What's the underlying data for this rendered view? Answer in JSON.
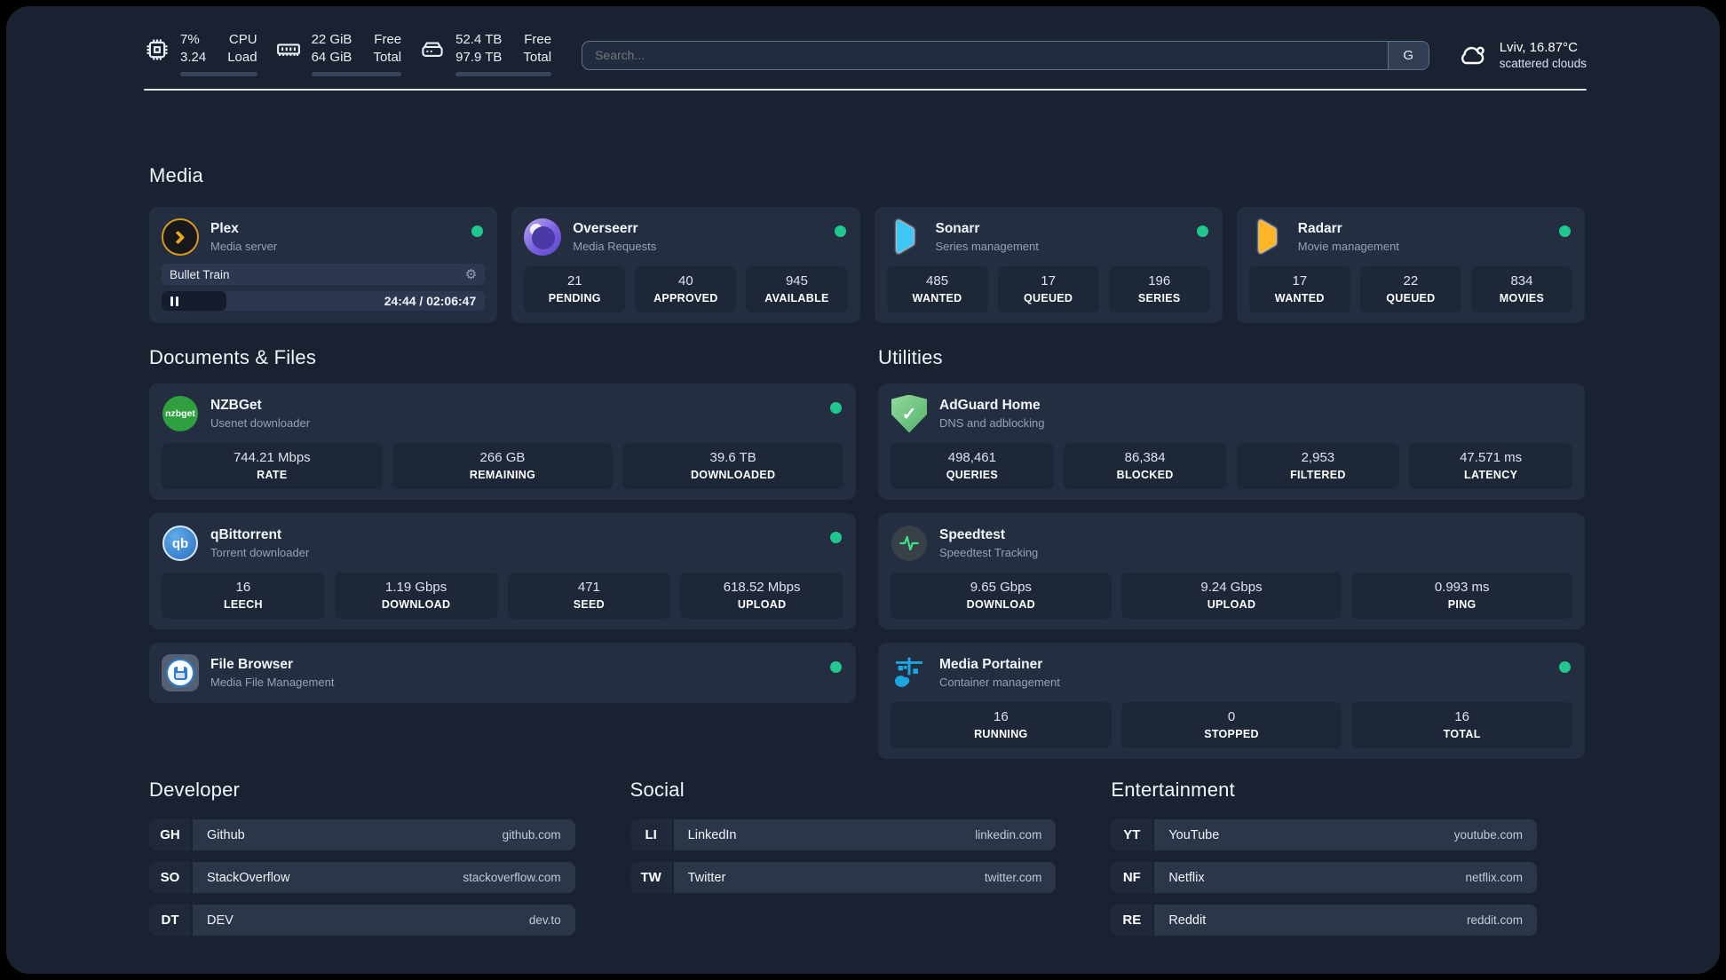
{
  "theme": {
    "accent_green": "#22c78e",
    "card_bg": "#242e41",
    "page_bg": "#1a2232"
  },
  "header": {
    "metrics": [
      {
        "icon": "cpu-icon",
        "value1": "7%",
        "value2": "3.24",
        "label1": "CPU",
        "label2": "Load",
        "progress": 12
      },
      {
        "icon": "ram-icon",
        "value1": "22 GiB",
        "value2": "64 GiB",
        "label1": "Free",
        "label2": "Total",
        "progress": 68
      },
      {
        "icon": "disk-icon",
        "value1": "52.4 TB",
        "value2": "97.9 TB",
        "label1": "Free",
        "label2": "Total",
        "progress": 47
      }
    ],
    "search": {
      "placeholder": "Search...",
      "provider_label": "G"
    },
    "weather": {
      "icon": "cloud-icon",
      "location": "Lviv, 16.87°C",
      "condition": "scattered clouds"
    }
  },
  "icons": {
    "nzbget_text": "nzbget",
    "qbittorrent_text": "qb",
    "adguard_check": "✓",
    "gear": "⚙"
  },
  "media": {
    "title": "Media",
    "cards": [
      {
        "name": "Plex",
        "subtitle": "Media server",
        "online": true,
        "player": {
          "now_playing": "Bullet Train",
          "time": "24:44 / 02:06:47",
          "progress": 20
        }
      },
      {
        "name": "Overseerr",
        "subtitle": "Media Requests",
        "online": true,
        "stats": [
          {
            "value": "21",
            "label": "PENDING"
          },
          {
            "value": "40",
            "label": "APPROVED"
          },
          {
            "value": "945",
            "label": "AVAILABLE"
          }
        ]
      },
      {
        "name": "Sonarr",
        "subtitle": "Series management",
        "online": true,
        "stats": [
          {
            "value": "485",
            "label": "WANTED"
          },
          {
            "value": "17",
            "label": "QUEUED"
          },
          {
            "value": "196",
            "label": "SERIES"
          }
        ]
      },
      {
        "name": "Radarr",
        "subtitle": "Movie management",
        "online": true,
        "stats": [
          {
            "value": "17",
            "label": "WANTED"
          },
          {
            "value": "22",
            "label": "QUEUED"
          },
          {
            "value": "834",
            "label": "MOVIES"
          }
        ]
      }
    ]
  },
  "documents": {
    "title": "Documents & Files",
    "cards": [
      {
        "name": "NZBGet",
        "subtitle": "Usenet downloader",
        "online": true,
        "stats": [
          {
            "value": "744.21 Mbps",
            "label": "RATE"
          },
          {
            "value": "266 GB",
            "label": "REMAINING"
          },
          {
            "value": "39.6 TB",
            "label": "DOWNLOADED"
          }
        ]
      },
      {
        "name": "qBittorrent",
        "subtitle": "Torrent downloader",
        "online": true,
        "stats": [
          {
            "value": "16",
            "label": "LEECH"
          },
          {
            "value": "1.19 Gbps",
            "label": "DOWNLOAD"
          },
          {
            "value": "471",
            "label": "SEED"
          },
          {
            "value": "618.52 Mbps",
            "label": "UPLOAD"
          }
        ]
      },
      {
        "name": "File Browser",
        "subtitle": "Media File Management",
        "online": true
      }
    ]
  },
  "utilities": {
    "title": "Utilities",
    "cards": [
      {
        "name": "AdGuard Home",
        "subtitle": "DNS and adblocking",
        "stats": [
          {
            "value": "498,461",
            "label": "QUERIES"
          },
          {
            "value": "86,384",
            "label": "BLOCKED"
          },
          {
            "value": "2,953",
            "label": "FILTERED"
          },
          {
            "value": "47.571 ms",
            "label": "LATENCY"
          }
        ]
      },
      {
        "name": "Speedtest",
        "subtitle": "Speedtest Tracking",
        "stats": [
          {
            "value": "9.65 Gbps",
            "label": "DOWNLOAD"
          },
          {
            "value": "9.24 Gbps",
            "label": "UPLOAD"
          },
          {
            "value": "0.993 ms",
            "label": "PING"
          }
        ]
      },
      {
        "name": "Media Portainer",
        "subtitle": "Container management",
        "online": true,
        "stats": [
          {
            "value": "16",
            "label": "RUNNING"
          },
          {
            "value": "0",
            "label": "STOPPED"
          },
          {
            "value": "16",
            "label": "TOTAL"
          }
        ]
      }
    ]
  },
  "links": {
    "developer": {
      "title": "Developer",
      "items": [
        {
          "abbr": "GH",
          "name": "Github",
          "url": "github.com"
        },
        {
          "abbr": "SO",
          "name": "StackOverflow",
          "url": "stackoverflow.com"
        },
        {
          "abbr": "DT",
          "name": "DEV",
          "url": "dev.to"
        }
      ]
    },
    "social": {
      "title": "Social",
      "items": [
        {
          "abbr": "LI",
          "name": "LinkedIn",
          "url": "linkedin.com"
        },
        {
          "abbr": "TW",
          "name": "Twitter",
          "url": "twitter.com"
        }
      ]
    },
    "entertainment": {
      "title": "Entertainment",
      "items": [
        {
          "abbr": "YT",
          "name": "YouTube",
          "url": "youtube.com"
        },
        {
          "abbr": "NF",
          "name": "Netflix",
          "url": "netflix.com"
        },
        {
          "abbr": "RE",
          "name": "Reddit",
          "url": "reddit.com"
        }
      ]
    }
  }
}
